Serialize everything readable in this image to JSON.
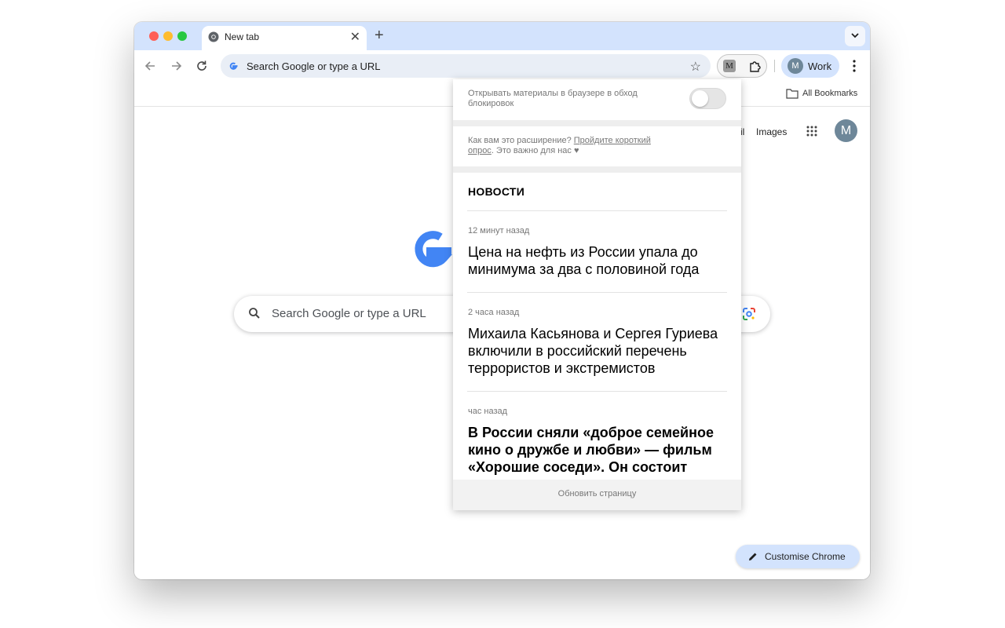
{
  "tab": {
    "title": "New tab",
    "close": "✕",
    "new_tab": "+"
  },
  "toolbar": {
    "omnibox_text": "Search Google or type a URL",
    "extension_letter": "M",
    "profile_letter": "M",
    "profile_label": "Work"
  },
  "bookmarks": {
    "all_bookmarks": "All Bookmarks"
  },
  "page": {
    "gmail": "il",
    "images": "Images",
    "avatar_letter": "M",
    "search_placeholder": "Search Google or type a URL",
    "customise_label": "Customise Chrome"
  },
  "popup": {
    "setting_label": "Открывать материалы в браузере в обход блокировок",
    "toggle_on": false,
    "survey_prefix": "Как вам это расширение? ",
    "survey_link": "Пройдите короткий опрос",
    "survey_suffix": ". Это важно для нас ♥",
    "news_header": "НОВОСТИ",
    "news": [
      {
        "time": "12 минут назад",
        "title": "Цена на нефть из России упала до минимума за два с половиной года"
      },
      {
        "time": "2 часа назад",
        "title": "Михаила Касьянова и Сергея Гуриева включили в российский перечень террористов и экстремистов"
      },
      {
        "time": "час назад",
        "title": "В России сняли «доброе семейное кино о дружбе и любви» — фильм «Хорошие соседи». Он состоит"
      }
    ],
    "footer": "Обновить страницу"
  },
  "colors": {
    "tabstrip": "#d3e3fd",
    "omnibox": "#e9eef6",
    "google_blue": "#4285f4",
    "avatar": "#6e8799"
  }
}
